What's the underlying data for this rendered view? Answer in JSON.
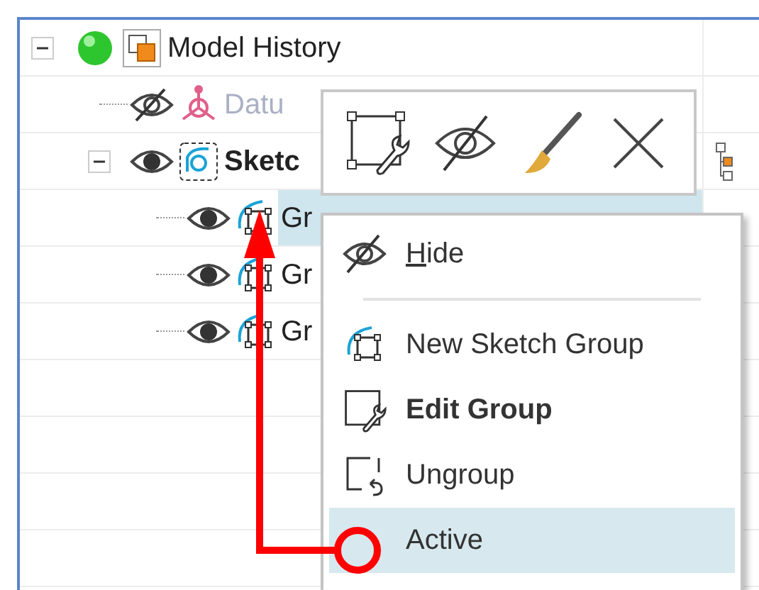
{
  "tree": {
    "items": [
      {
        "label": "Model History",
        "kind": "root",
        "expanded": true,
        "children": [
          {
            "label": "Datu",
            "kind": "datum",
            "visible": false,
            "disabled": true
          },
          {
            "label": "Sketc",
            "kind": "sketch",
            "expanded": true,
            "visible": true,
            "bold": true,
            "side_icon": true,
            "children": [
              {
                "label": "Gr",
                "kind": "group",
                "visible": true,
                "selected": true
              },
              {
                "label": "Gr",
                "kind": "group",
                "visible": true,
                "selected": false
              },
              {
                "label": "Gr",
                "kind": "group",
                "visible": true,
                "selected": false
              }
            ]
          }
        ]
      }
    ]
  },
  "mini_toolbar": {
    "buttons": [
      {
        "kind": "edit"
      },
      {
        "kind": "hide"
      },
      {
        "kind": "paint"
      },
      {
        "kind": "delete"
      }
    ]
  },
  "context_menu": {
    "items": [
      {
        "kind": "hide",
        "label": "Hide",
        "underline_first": true,
        "bold": false,
        "selected": false
      },
      {
        "kind": "separator"
      },
      {
        "kind": "new_group",
        "label": "New Sketch Group",
        "underline_first": false,
        "bold": false,
        "selected": false
      },
      {
        "kind": "edit",
        "label": "Edit Group",
        "underline_first": false,
        "bold": true,
        "selected": false
      },
      {
        "kind": "ungroup",
        "label": "Ungroup",
        "underline_first": false,
        "bold": false,
        "selected": false
      },
      {
        "kind": "active",
        "label": "Active",
        "underline_first": false,
        "bold": false,
        "selected": true
      }
    ]
  }
}
